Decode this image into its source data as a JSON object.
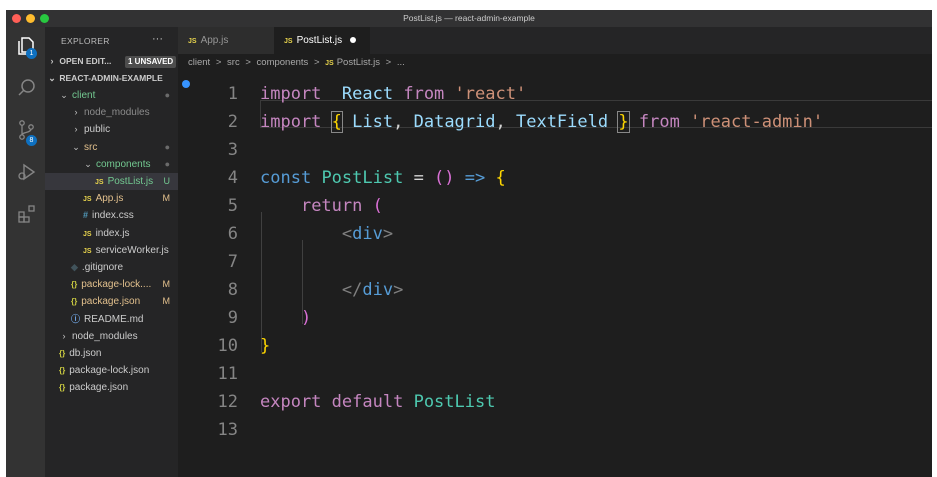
{
  "window": {
    "title": "PostList.js — react-admin-example",
    "colors": {
      "close": "#ff5f57",
      "minimize": "#febc2e",
      "maximize": "#28c840"
    }
  },
  "activity_bar": {
    "items": [
      {
        "icon": "files-icon",
        "badge": "1"
      },
      {
        "icon": "search-icon",
        "badge": ""
      },
      {
        "icon": "source-control-icon",
        "badge": "8"
      },
      {
        "icon": "run-debug-icon",
        "badge": ""
      },
      {
        "icon": "extensions-icon",
        "badge": ""
      }
    ]
  },
  "explorer": {
    "title": "EXPLORER",
    "more": "···",
    "open_editors": {
      "label": "OPEN EDIT...",
      "badge": "1 UNSAVED"
    },
    "root": "REACT-ADMIN-EXAMPLE",
    "tree": [
      {
        "label": "client",
        "type": "folder-open",
        "deco": "●",
        "color": "#73c991"
      },
      {
        "label": "node_modules",
        "type": "folder",
        "deco": "",
        "color": "#8c8c8c"
      },
      {
        "label": "public",
        "type": "folder",
        "deco": "",
        "color": "#cccccc"
      },
      {
        "label": "src",
        "type": "folder-open",
        "deco": "●",
        "color": "#e2c08d"
      },
      {
        "label": "components",
        "type": "folder-open",
        "deco": "●",
        "color": "#73c991"
      },
      {
        "label": "PostList.js",
        "type": "js",
        "deco": "U",
        "color": "#73c991"
      },
      {
        "label": "App.js",
        "type": "js",
        "deco": "M",
        "color": "#e2c08d"
      },
      {
        "label": "index.css",
        "type": "css",
        "deco": "",
        "color": "#cccccc"
      },
      {
        "label": "index.js",
        "type": "js",
        "deco": "",
        "color": "#cccccc"
      },
      {
        "label": "serviceWorker.js",
        "type": "js",
        "deco": "",
        "color": "#cccccc"
      },
      {
        "label": ".gitignore",
        "type": "git",
        "deco": "",
        "color": "#cccccc"
      },
      {
        "label": "package-lock....",
        "type": "json",
        "deco": "M",
        "color": "#e2c08d"
      },
      {
        "label": "package.json",
        "type": "json",
        "deco": "M",
        "color": "#e2c08d"
      },
      {
        "label": "README.md",
        "type": "info",
        "deco": "",
        "color": "#cccccc"
      },
      {
        "label": "node_modules",
        "type": "folder",
        "deco": "",
        "color": "#cccccc"
      },
      {
        "label": "db.json",
        "type": "json",
        "deco": "",
        "color": "#cccccc"
      },
      {
        "label": "package-lock.json",
        "type": "json",
        "deco": "",
        "color": "#cccccc"
      },
      {
        "label": "package.json",
        "type": "json",
        "deco": "",
        "color": "#cccccc"
      }
    ]
  },
  "tabs": [
    {
      "icon": "JS",
      "label": "App.js",
      "active": false
    },
    {
      "icon": "JS",
      "label": "PostList.js",
      "active": true,
      "dirty": true
    }
  ],
  "breadcrumbs": [
    "client",
    ">",
    "src",
    ">",
    "components",
    ">",
    "JS",
    "PostList.js",
    ">",
    "..."
  ],
  "editor": {
    "line_numbers": [
      "1",
      "2",
      "3",
      "4",
      "5",
      "6",
      "7",
      "8",
      "9",
      "10",
      "11",
      "12",
      "13"
    ],
    "lines": [
      [
        [
          "kw",
          "import"
        ],
        [
          "",
          "  "
        ],
        [
          "id",
          "React"
        ],
        [
          "",
          " "
        ],
        [
          "kw",
          "from"
        ],
        [
          "",
          " "
        ],
        [
          "str",
          "'react'"
        ]
      ],
      [
        [
          "kw",
          "import"
        ],
        [
          "",
          " "
        ],
        [
          "brc",
          "{"
        ],
        [
          "",
          " "
        ],
        [
          "id",
          "List"
        ],
        [
          "",
          ", "
        ],
        [
          "id",
          "Datagrid"
        ],
        [
          "",
          ", "
        ],
        [
          "id",
          "TextField"
        ],
        [
          "",
          " "
        ],
        [
          "brc",
          "}"
        ],
        [
          "",
          " "
        ],
        [
          "kw",
          "from"
        ],
        [
          "",
          " "
        ],
        [
          "str",
          "'react-admin'"
        ]
      ],
      [],
      [
        [
          "kw2",
          "const"
        ],
        [
          "",
          " "
        ],
        [
          "cls",
          "PostList"
        ],
        [
          "",
          " = "
        ],
        [
          "brc2",
          "()"
        ],
        [
          "",
          " "
        ],
        [
          "kw2",
          "=>"
        ],
        [
          "",
          " "
        ],
        [
          "brc",
          "{"
        ]
      ],
      [
        [
          "",
          "    "
        ],
        [
          "kw",
          "return"
        ],
        [
          "",
          " "
        ],
        [
          "brc2",
          "("
        ]
      ],
      [
        [
          "",
          "        "
        ],
        [
          "pun",
          "<"
        ],
        [
          "tag",
          "div"
        ],
        [
          "pun",
          ">"
        ]
      ],
      [],
      [
        [
          "",
          "        "
        ],
        [
          "pun",
          "</"
        ],
        [
          "tag",
          "div"
        ],
        [
          "pun",
          ">"
        ]
      ],
      [
        [
          "",
          "    "
        ],
        [
          "brc2",
          ")"
        ]
      ],
      [
        [
          "brc",
          "}"
        ]
      ],
      [],
      [
        [
          "kw",
          "export"
        ],
        [
          "",
          " "
        ],
        [
          "kw",
          "default"
        ],
        [
          "",
          " "
        ],
        [
          "cls",
          "PostList"
        ]
      ],
      []
    ]
  }
}
